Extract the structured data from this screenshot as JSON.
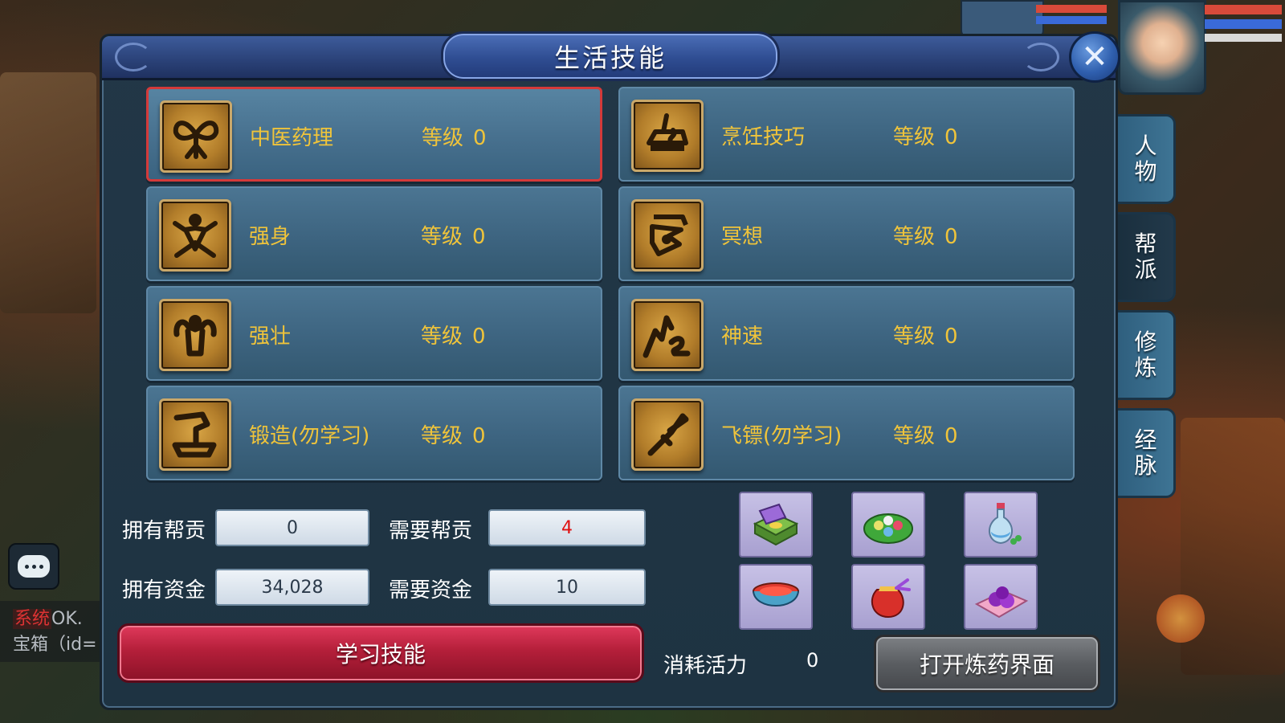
{
  "window": {
    "title": "生活技能",
    "close_icon": "✕"
  },
  "skills": [
    {
      "name": "中医药理",
      "level_label": "等级",
      "level": "0",
      "icon": "herb-icon",
      "selected": true
    },
    {
      "name": "烹饪技巧",
      "level_label": "等级",
      "level": "0",
      "icon": "cooking-icon",
      "selected": false
    },
    {
      "name": "强身",
      "level_label": "等级",
      "level": "0",
      "icon": "body-strength-icon",
      "selected": false
    },
    {
      "name": "冥想",
      "level_label": "等级",
      "level": "0",
      "icon": "meditation-icon",
      "selected": false
    },
    {
      "name": "强壮",
      "level_label": "等级",
      "level": "0",
      "icon": "muscle-icon",
      "selected": false
    },
    {
      "name": "神速",
      "level_label": "等级",
      "level": "0",
      "icon": "speed-icon",
      "selected": false
    },
    {
      "name": "锻造(勿学习)",
      "level_label": "等级",
      "level": "0",
      "icon": "forging-icon",
      "selected": false
    },
    {
      "name": "飞镖(勿学习)",
      "level_label": "等级",
      "level": "0",
      "icon": "dart-icon",
      "selected": false
    }
  ],
  "side_tabs": [
    {
      "label_1": "人",
      "label_2": "物",
      "active": false
    },
    {
      "label_1": "帮",
      "label_2": "派",
      "active": true
    },
    {
      "label_1": "修",
      "label_2": "炼",
      "active": false
    },
    {
      "label_1": "经",
      "label_2": "脉",
      "active": false
    }
  ],
  "cost": {
    "own_contribution_label": "拥有帮贡",
    "own_contribution": "0",
    "need_contribution_label": "需要帮贡",
    "need_contribution": "4",
    "own_funds_label": "拥有资金",
    "own_funds": "34,028",
    "need_funds_label": "需要资金",
    "need_funds": "10"
  },
  "buttons": {
    "learn": "学习技能",
    "open_alchemy": "打开炼药界面"
  },
  "stamina": {
    "label": "消耗活力",
    "value": "0"
  },
  "items": [
    "jewel-box-icon",
    "leaf-dumplings-icon",
    "potion-flask-icon",
    "red-bowl-icon",
    "lucky-bag-icon",
    "purple-pills-icon"
  ],
  "chat": {
    "system_tag": "系统",
    "line_1": "OK.",
    "line_2": "宝箱（id="
  },
  "colors": {
    "skill_text": "#f0c43a",
    "selected_border": "#d43a3a",
    "need_value": "#e01010",
    "learn_button": "#b41f3a"
  }
}
